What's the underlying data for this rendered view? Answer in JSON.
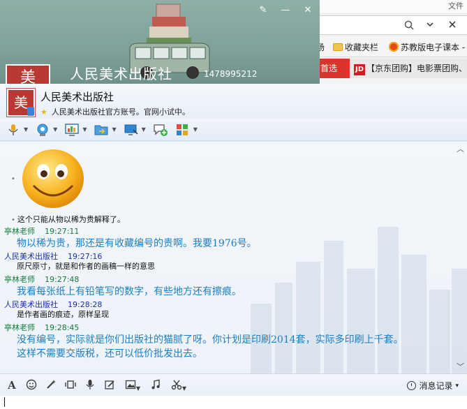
{
  "browser": {
    "file_label": "文件",
    "bookmarks": [
      {
        "label": "场",
        "icon": "none"
      },
      {
        "label": "收藏夹栏",
        "icon": "folder-icon"
      },
      {
        "label": "苏教版电子课本 -",
        "icon": "sun-icon"
      }
    ],
    "tabs": [
      {
        "label": "首选"
      },
      {
        "label": "【京东团购】电影票团购、"
      }
    ],
    "jd_logo": "JD"
  },
  "chat": {
    "banner_title": "人民美术出版社",
    "banner_qq": "1478995212",
    "avatar_char": "美",
    "contact_name": "人民美术出版社",
    "signature": "人民美术出版社官方账号。官网小试中。",
    "controls": {
      "skin": "✎",
      "minimize": "—",
      "close": "✕"
    },
    "history_label": "消息记录",
    "history_arrow": "▾",
    "scroll_up": "︿",
    "scroll_down": "﹀"
  },
  "messages": [
    {
      "sender": "",
      "time": "",
      "text": "这个只能从物以稀为贵解释了。",
      "style": "me-plain"
    },
    {
      "sender": "亭林老师",
      "time": "19:27:11",
      "text": "物以稀为贵，那还是有收藏编号的贵啊。我要1976号。",
      "style": "them"
    },
    {
      "sender": "人民美术出版社",
      "time": "19:27:16",
      "text": "原尺原寸，就是和作者的画稿一样的意思",
      "style": "me"
    },
    {
      "sender": "亭林老师",
      "time": "19:27:48",
      "text": "我看每张纸上有铅笔写的数字，有些地方还有擦痕。",
      "style": "them"
    },
    {
      "sender": "人民美术出版社",
      "time": "19:28:28",
      "text": "是作者画的痕迹，原样呈现",
      "style": "me"
    },
    {
      "sender": "亭林老师",
      "time": "19:28:45",
      "text": "没有编号，实际就是你们出版社的猫腻了呀。你计划是印刷2014套，实际多印刷上千套。",
      "text2": "这样不需要交版税，还可以低价批发出去。",
      "style": "them"
    }
  ]
}
